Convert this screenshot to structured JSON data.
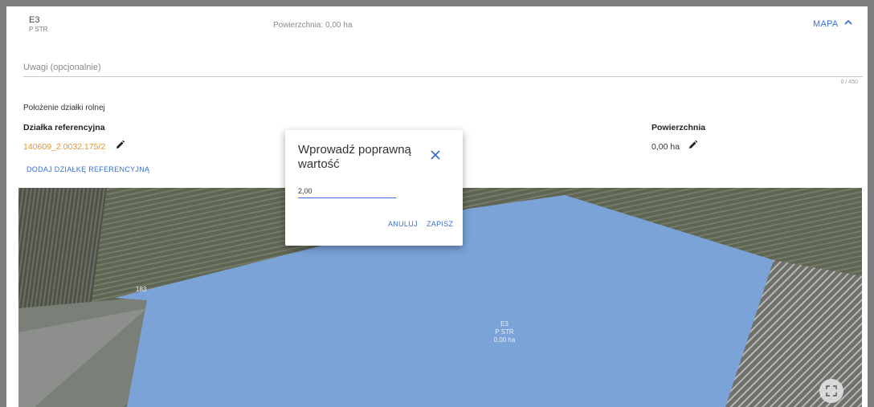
{
  "header": {
    "code": "E3",
    "subcode": "P STR",
    "area": "Powierzchnia: 0,00 ha",
    "map_label": "MAPA",
    "chevron_icon": "chevron-up-icon"
  },
  "notes": {
    "placeholder": "Uwagi (opcjonalnie)",
    "counter": "0 / 450"
  },
  "location": {
    "title": "Położenie działki rolnej",
    "col_ref": "Działka referencyjna",
    "col_area": "Powierzchnia",
    "ref_value": "140609_2.0032.175/2",
    "area_value": "0,00 ha",
    "edit_icon": "pencil-icon",
    "add_ref": "DODAJ DZIAŁKĘ REFERENCYJNĄ"
  },
  "map": {
    "parcel_code": "E3",
    "parcel_sub": "P STR",
    "parcel_area": "0,00 ha",
    "plot_number": "183",
    "fullscreen_icon": "fullscreen-icon",
    "colors": {
      "parcel": "#7ba3d8",
      "field": "#6a6e62"
    }
  },
  "dialog": {
    "title": "Wprowadź poprawną wartość",
    "input_value": "2,00",
    "cancel": "ANULUJ",
    "save": "ZAPISZ",
    "close_icon": "close-icon"
  },
  "colors": {
    "accent": "#3b6fd6",
    "link_orange": "#e8962a"
  }
}
